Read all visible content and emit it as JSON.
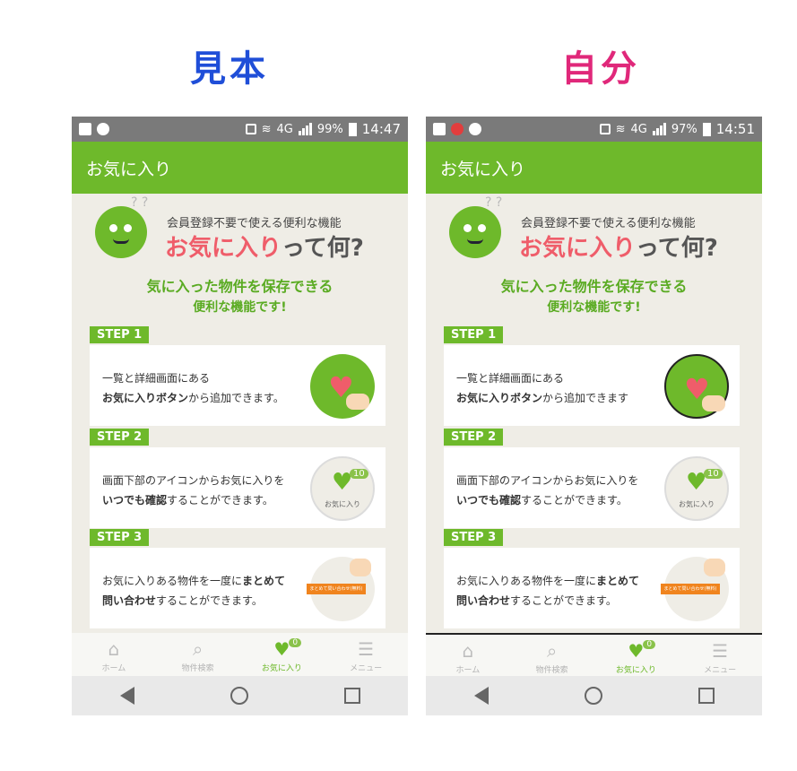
{
  "labels": {
    "left": "見本",
    "right": "自分"
  },
  "phones": [
    {
      "status": {
        "battery": "99%",
        "time": "14:47",
        "network": "4G"
      },
      "appbar_title": "お気に入り",
      "intro": {
        "sub": "会員登録不要で使える便利な機能",
        "title_highlight": "お気に入り",
        "title_rest": "って何?",
        "line1": "気に入った物件を保存できる",
        "line2": "便利な機能です!"
      },
      "steps": [
        {
          "badge": "STEP 1",
          "text1": "一覧と詳細画面にある",
          "text2_bold": "お気に入りボタン",
          "text2_rest": "から追加できます。"
        },
        {
          "badge": "STEP 2",
          "text1": "画面下部のアイコンからお気に入りを",
          "text2_bold": "いつでも確認",
          "text2_rest": "することができます。",
          "count": "10",
          "icon_label": "お気に入り"
        },
        {
          "badge": "STEP 3",
          "text1_rest": "お気に入りある物件を一度に",
          "text1_bold": "まとめて",
          "text2_bold": "問い合わせ",
          "text2_rest": "することができます。",
          "btn_label": "まとめて問い合わせ(無料)"
        }
      ],
      "tabs": [
        {
          "label": "ホーム",
          "icon": "home-icon"
        },
        {
          "label": "物件検索",
          "icon": "search-icon"
        },
        {
          "label": "お気に入り",
          "icon": "heart-icon",
          "count": "0"
        },
        {
          "label": "メニュー",
          "icon": "menu-icon"
        }
      ]
    },
    {
      "status": {
        "battery": "97%",
        "time": "14:51",
        "network": "4G"
      },
      "appbar_title": "お気に入り",
      "intro": {
        "sub": "会員登録不要で使える便利な機能",
        "title_highlight": "お気に入り",
        "title_rest": "って何?",
        "line1": "気に入った物件を保存できる",
        "line2": "便利な機能です!"
      },
      "steps": [
        {
          "badge": "STEP 1",
          "text1": "一覧と詳細画面にある",
          "text2_bold": "お気に入りボタン",
          "text2_rest": "から追加できます"
        },
        {
          "badge": "STEP 2",
          "text1": "画面下部のアイコンからお気に入りを",
          "text2_bold": "いつでも確認",
          "text2_rest": "することができます。",
          "count": "10",
          "icon_label": "お気に入り"
        },
        {
          "badge": "STEP 3",
          "text1_rest": "お気に入りある物件を一度に",
          "text1_bold": "まとめて",
          "text2_bold": "問い合わせ",
          "text2_rest": "することができます。",
          "btn_label": "まとめて問い合わせ(無料)"
        }
      ],
      "tabs": [
        {
          "label": "ホーム",
          "icon": "home-icon"
        },
        {
          "label": "物件検索",
          "icon": "search-icon"
        },
        {
          "label": "お気に入り",
          "icon": "heart-icon",
          "count": "0"
        },
        {
          "label": "メニュー",
          "icon": "menu-icon"
        }
      ]
    }
  ],
  "colors": {
    "brand_green": "#6eb92b",
    "accent_pink": "#ef5d6a",
    "label_blue": "#1f4ed8",
    "label_magenta": "#e0287a",
    "orange": "#f0841e"
  }
}
